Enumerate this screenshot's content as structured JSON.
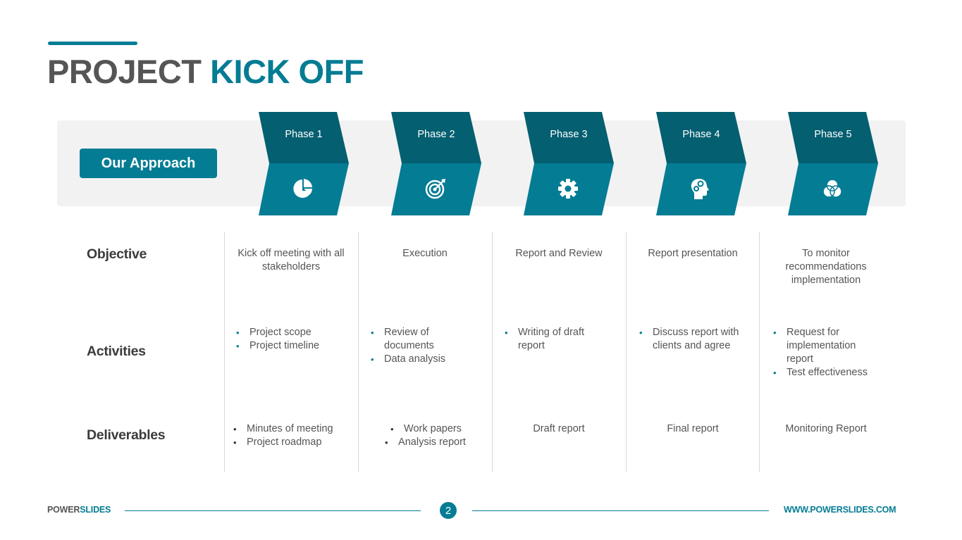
{
  "title": {
    "part1": "PROJECT",
    "part2": "KICK OFF"
  },
  "colors": {
    "accent": "#047C94",
    "accent_dark": "#045F70",
    "text": "#555555",
    "band": "#F2F2F2"
  },
  "approach_button": "Our Approach",
  "phases": [
    {
      "label": "Phase 1",
      "icon": "pie-chart-icon"
    },
    {
      "label": "Phase 2",
      "icon": "target-icon"
    },
    {
      "label": "Phase 3",
      "icon": "gear-icon"
    },
    {
      "label": "Phase 4",
      "icon": "head-gears-icon"
    },
    {
      "label": "Phase 5",
      "icon": "venn-diagram-icon"
    }
  ],
  "rows": {
    "objective": "Objective",
    "activities": "Activities",
    "deliverables": "Deliverables"
  },
  "objectives": [
    "Kick off meeting with all stakeholders",
    "Execution",
    "Report and Review",
    "Report presentation",
    "To monitor recommendations implementation"
  ],
  "activities": [
    [
      "Project scope",
      "Project timeline"
    ],
    [
      "Review of documents",
      "Data analysis"
    ],
    [
      "Writing of draft report"
    ],
    [
      "Discuss report with clients and agree"
    ],
    [
      "Request for implementation report",
      "Test effectiveness"
    ]
  ],
  "deliverables": {
    "phase1": [
      "Minutes of meeting",
      "Project roadmap"
    ],
    "phase2": [
      "Work papers",
      "Analysis report"
    ],
    "phase3": "Draft report",
    "phase4": "Final report",
    "phase5": "Monitoring Report"
  },
  "footer": {
    "brand_part1": "POWER",
    "brand_part2": "SLIDES",
    "page_number": "2",
    "url": "WWW.POWERSLIDES.COM"
  }
}
